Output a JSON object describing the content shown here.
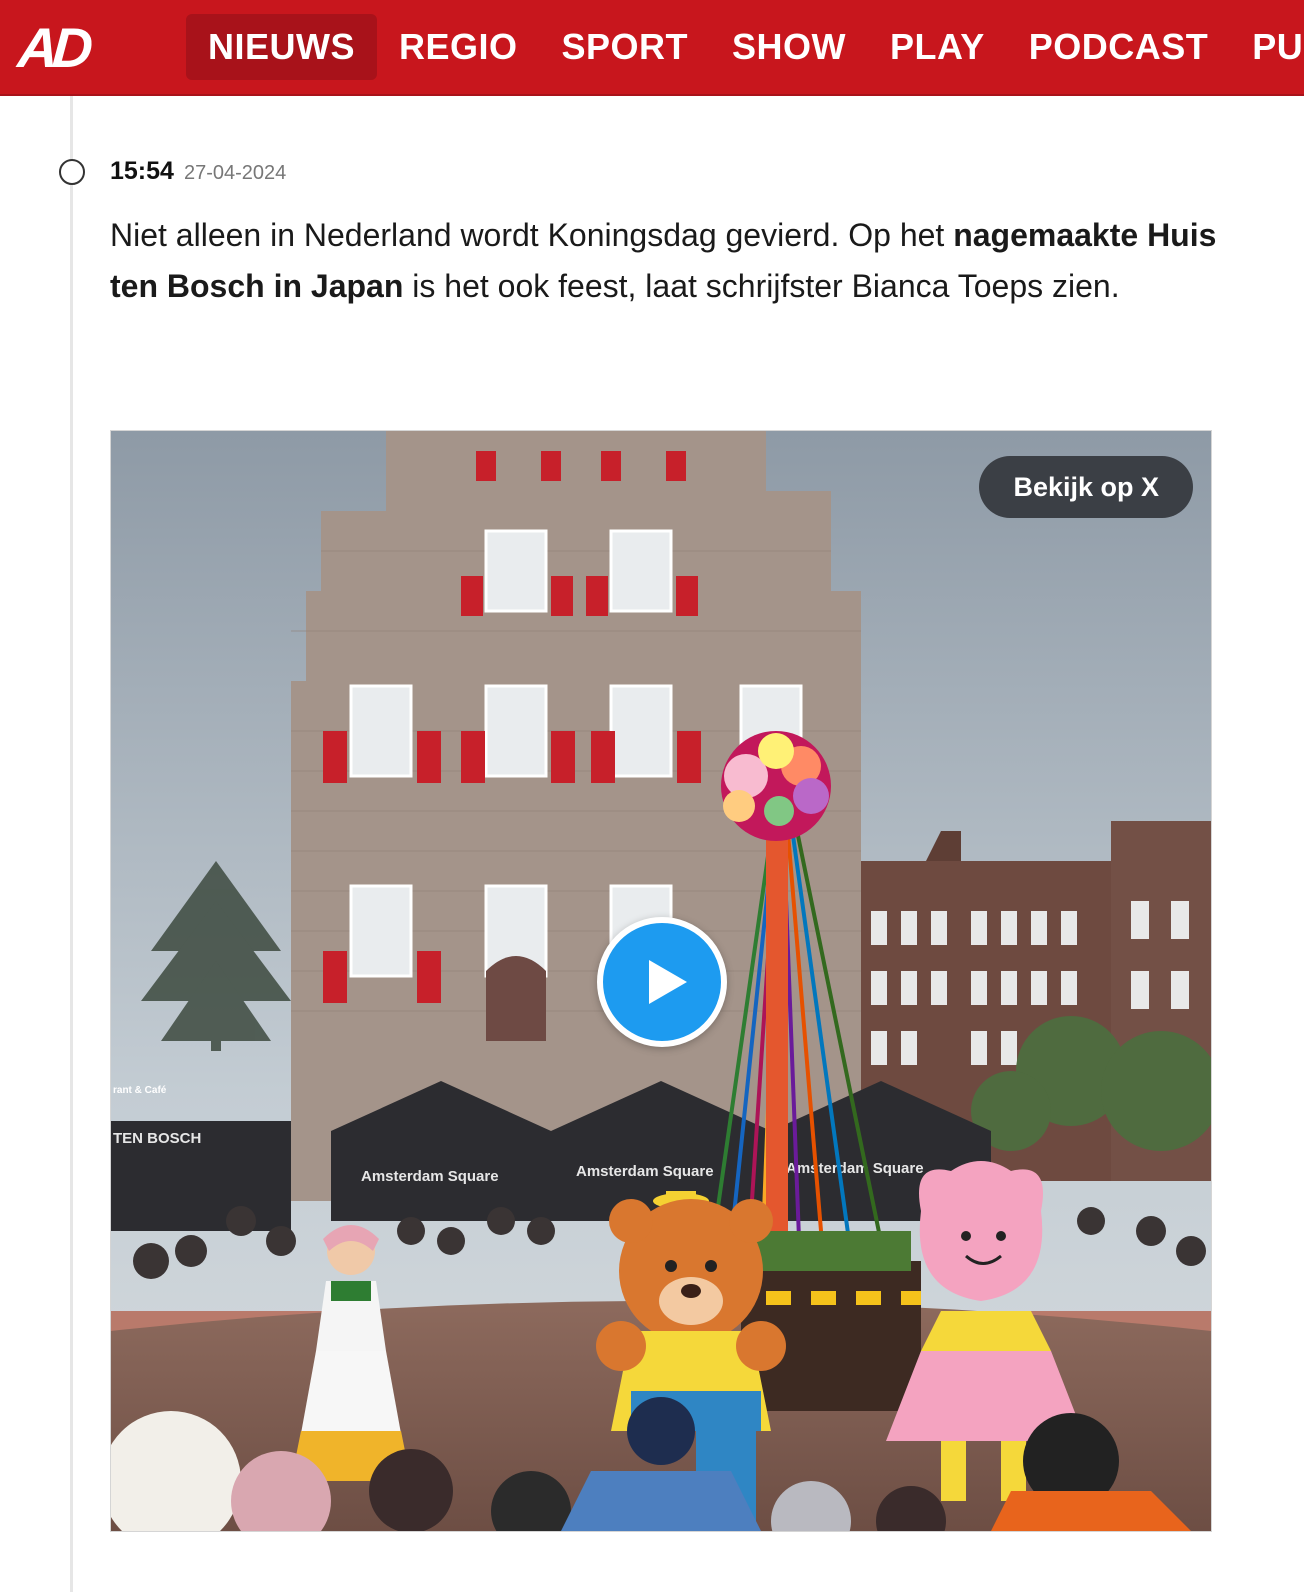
{
  "header": {
    "logo": "AD",
    "nav": [
      {
        "label": "NIEUWS",
        "active": true
      },
      {
        "label": "REGIO"
      },
      {
        "label": "SPORT"
      },
      {
        "label": "SHOW"
      },
      {
        "label": "PLAY"
      },
      {
        "label": "PODCAST"
      },
      {
        "label": "PUZZ"
      }
    ],
    "brand_color": "#c8161d"
  },
  "post": {
    "time": "15:54",
    "date": "27-04-2024",
    "text_1": "Niet alleen in Nederland wordt Koningsdag gevierd. Op het ",
    "text_bold": "nagemaakte Huis ten Bosch in Japan",
    "text_2": " is het ook feest, laat schrijfster Bianca Toeps zien."
  },
  "embed": {
    "x_button_label": "Bekijk op X",
    "play_icon": "play-icon",
    "signs": [
      "Amsterdam Square",
      "Amsterdam Square",
      "Amsterdam Square",
      "TEN BOSCH",
      "rant & Café"
    ]
  }
}
